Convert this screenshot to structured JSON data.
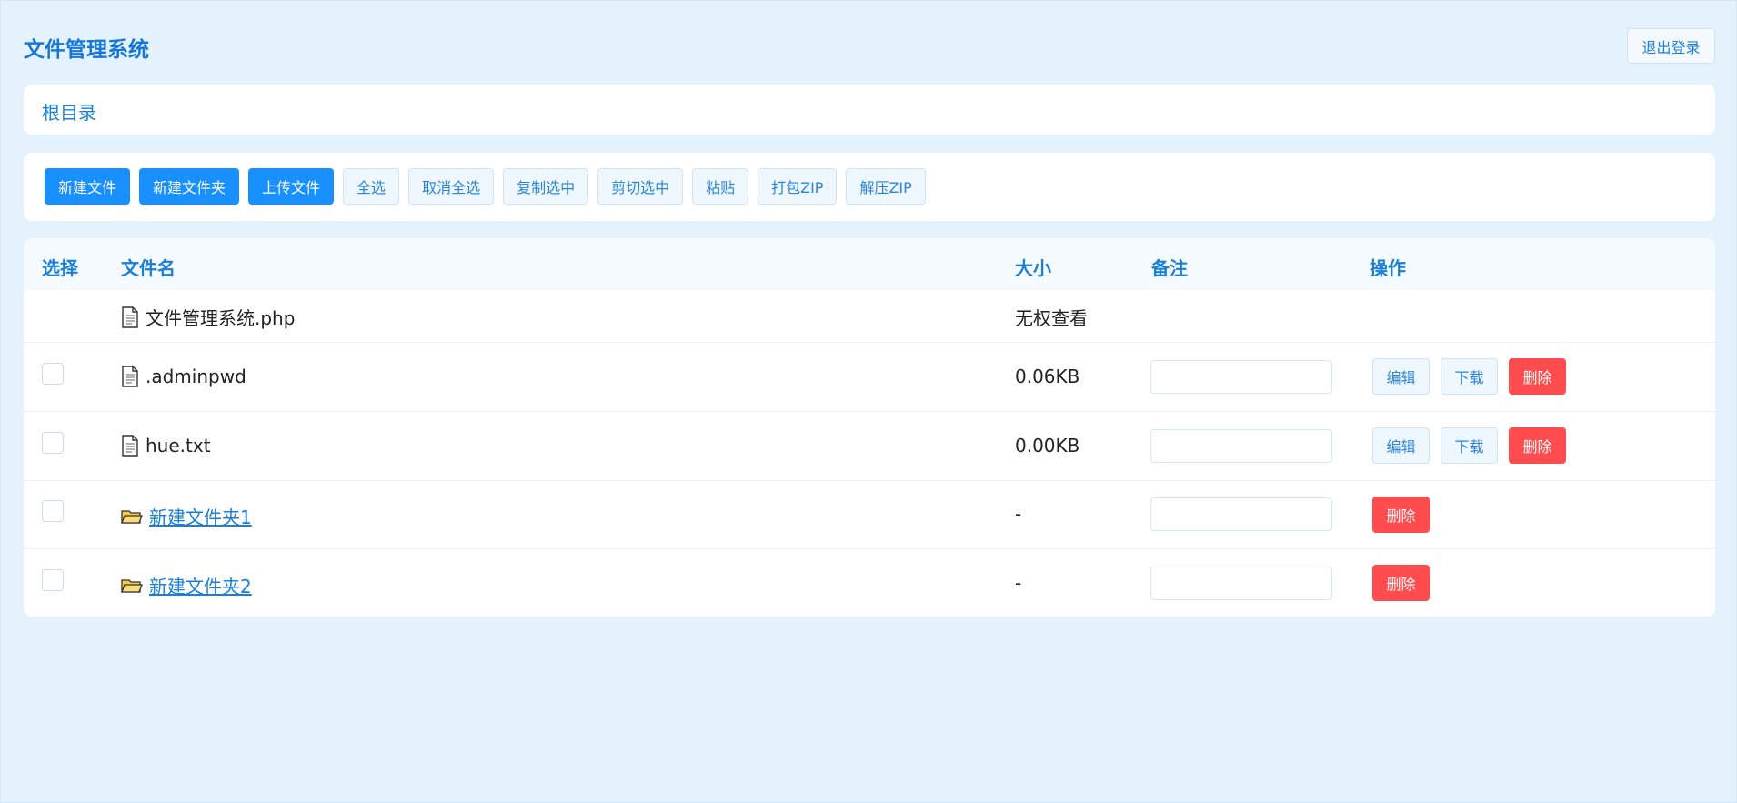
{
  "header": {
    "title": "文件管理系统",
    "logout_label": "退出登录"
  },
  "breadcrumb": {
    "root_label": "根目录"
  },
  "toolbar": {
    "new_file": "新建文件",
    "new_folder": "新建文件夹",
    "upload": "上传文件",
    "select_all": "全选",
    "deselect_all": "取消全选",
    "copy_selected": "复制选中",
    "cut_selected": "剪切选中",
    "paste": "粘贴",
    "zip": "打包ZIP",
    "unzip": "解压ZIP"
  },
  "table": {
    "columns": {
      "select": "选择",
      "name": "文件名",
      "size": "大小",
      "note": "备注",
      "actions": "操作"
    },
    "rows": [
      {
        "name": "文件管理系统.php",
        "size": "无权查看",
        "type": "file"
      },
      {
        "name": ".adminpwd",
        "size": "0.06KB",
        "type": "file",
        "note": ""
      },
      {
        "name": "hue.txt",
        "size": "0.00KB",
        "type": "file",
        "note": ""
      },
      {
        "name": "新建文件夹1",
        "size": "-",
        "type": "folder",
        "note": ""
      },
      {
        "name": "新建文件夹2",
        "size": "-",
        "type": "folder",
        "note": ""
      }
    ],
    "actions": {
      "edit": "编辑",
      "download": "下载",
      "delete": "删除"
    }
  },
  "icons": {
    "file": "file-icon",
    "folder": "folder-icon"
  },
  "colors": {
    "background": "#e4f2fd",
    "accent": "#1890ff",
    "danger": "#ff4d4f",
    "link": "#1a7fd9"
  }
}
